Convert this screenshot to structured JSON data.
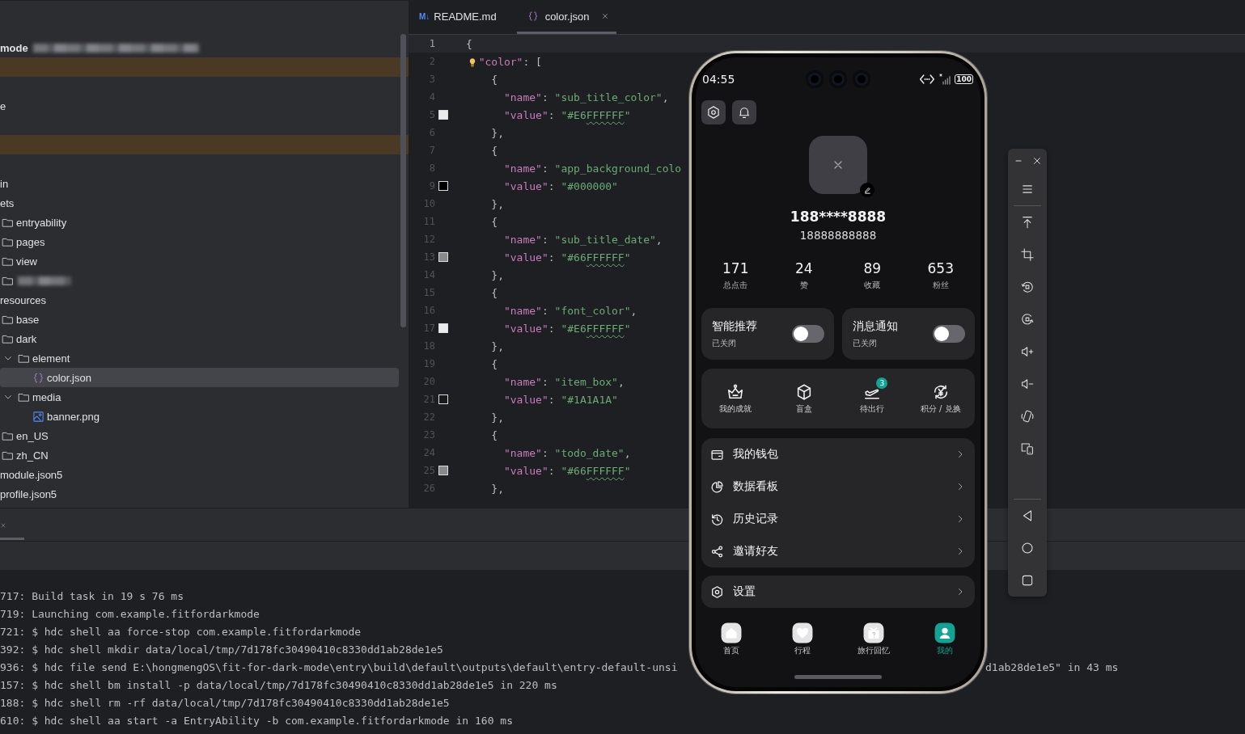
{
  "project_tree": {
    "items": [
      {
        "kind": "root",
        "label": "mode",
        "selected": false
      },
      {
        "kind": "blank",
        "highlighted": true
      },
      {
        "kind": "blank",
        "highlighted": false
      },
      {
        "kind": "plain",
        "label": "e",
        "selected": false
      },
      {
        "kind": "blank",
        "highlighted": false
      },
      {
        "kind": "blank",
        "highlighted": true
      },
      {
        "kind": "blank",
        "highlighted": false
      },
      {
        "kind": "plain",
        "label": "in",
        "selected": false
      },
      {
        "kind": "plain",
        "label": "ets",
        "selected": false,
        "children": [
          {
            "kind": "folder",
            "label": "entryability",
            "selected": false
          },
          {
            "kind": "folder",
            "label": "pages",
            "selected": false
          },
          {
            "kind": "folder",
            "label": "view",
            "selected": false
          },
          {
            "kind": "redacted-folder",
            "selected": false
          }
        ]
      },
      {
        "kind": "plain",
        "label": "resources",
        "selected": false,
        "children": [
          {
            "kind": "folder",
            "label": "base",
            "selected": false
          },
          {
            "kind": "folder",
            "label": "dark",
            "selected": false,
            "children": [
              {
                "kind": "folder",
                "label": "element",
                "selected": false,
                "expanded": true,
                "children": [
                  {
                    "kind": "json",
                    "label": "color.json",
                    "selected": true
                  }
                ]
              },
              {
                "kind": "folder",
                "label": "media",
                "selected": false,
                "expanded": true,
                "children": [
                  {
                    "kind": "image",
                    "label": "banner.png",
                    "selected": false
                  }
                ]
              }
            ]
          },
          {
            "kind": "folder",
            "label": "en_US",
            "selected": false
          },
          {
            "kind": "folder",
            "label": "zh_CN",
            "selected": false
          }
        ]
      },
      {
        "kind": "plain",
        "label": "module.json5",
        "selected": false
      },
      {
        "kind": "plain",
        "label": "profile.json5",
        "selected": false
      }
    ]
  },
  "editor": {
    "tabs": [
      {
        "kind": "markdown",
        "badge": "M↓",
        "label": "README.md",
        "selected": false
      },
      {
        "kind": "json",
        "label": "color.json",
        "selected": true
      }
    ],
    "lines": [
      {
        "n": "1",
        "text": "{",
        "current": true,
        "hint": false,
        "spellcheck": false
      },
      {
        "n": "2",
        "text": "  \"color\": [",
        "current": false,
        "hint": true,
        "spellcheck": false
      },
      {
        "n": "3",
        "text": "    {",
        "current": false,
        "hint": false,
        "spellcheck": false
      },
      {
        "n": "4",
        "text": "      \"name\": \"sub_title_color\",",
        "current": false,
        "hint": false,
        "spellcheck": false
      },
      {
        "n": "5",
        "text": "      \"value\": \"#E6FFFFFF\"",
        "current": false,
        "hint": false,
        "spellcheck": true,
        "color": "#ebebeb"
      },
      {
        "n": "6",
        "text": "    },",
        "current": false,
        "hint": false,
        "spellcheck": false
      },
      {
        "n": "7",
        "text": "    {",
        "current": false,
        "hint": false,
        "spellcheck": false
      },
      {
        "n": "8",
        "text": "      \"name\": \"app_background_colo",
        "current": false,
        "hint": false,
        "spellcheck": false
      },
      {
        "n": "9",
        "text": "      \"value\": \"#000000\"",
        "current": false,
        "hint": false,
        "spellcheck": false,
        "color": "#000000"
      },
      {
        "n": "10",
        "text": "    },",
        "current": false,
        "hint": false,
        "spellcheck": false
      },
      {
        "n": "11",
        "text": "    {",
        "current": false,
        "hint": false,
        "spellcheck": false
      },
      {
        "n": "12",
        "text": "      \"name\": \"sub_title_date\",",
        "current": false,
        "hint": false,
        "spellcheck": false
      },
      {
        "n": "13",
        "text": "      \"value\": \"#66FFFFFF\"",
        "current": false,
        "hint": false,
        "spellcheck": true,
        "color": "#8a8a8a"
      },
      {
        "n": "14",
        "text": "    },",
        "current": false,
        "hint": false,
        "spellcheck": false
      },
      {
        "n": "15",
        "text": "    {",
        "current": false,
        "hint": false,
        "spellcheck": false
      },
      {
        "n": "16",
        "text": "      \"name\": \"font_color\",",
        "current": false,
        "hint": false,
        "spellcheck": false
      },
      {
        "n": "17",
        "text": "      \"value\": \"#E6FFFFFF\"",
        "current": false,
        "hint": false,
        "spellcheck": true,
        "color": "#ebebeb"
      },
      {
        "n": "18",
        "text": "    },",
        "current": false,
        "hint": false,
        "spellcheck": false
      },
      {
        "n": "19",
        "text": "    {",
        "current": false,
        "hint": false,
        "spellcheck": false
      },
      {
        "n": "20",
        "text": "      \"name\": \"item_box\",",
        "current": false,
        "hint": false,
        "spellcheck": false
      },
      {
        "n": "21",
        "text": "      \"value\": \"#1A1A1A\"",
        "current": false,
        "hint": false,
        "spellcheck": false,
        "color": "#1a1a1a"
      },
      {
        "n": "22",
        "text": "    },",
        "current": false,
        "hint": false,
        "spellcheck": false
      },
      {
        "n": "23",
        "text": "    {",
        "current": false,
        "hint": false,
        "spellcheck": false
      },
      {
        "n": "24",
        "text": "      \"name\": \"todo_date\",",
        "current": false,
        "hint": false,
        "spellcheck": false
      },
      {
        "n": "25",
        "text": "      \"value\": \"#66FFFFFF\"",
        "current": false,
        "hint": false,
        "spellcheck": true,
        "color": "#8a8a8a"
      },
      {
        "n": "26",
        "text": "    },",
        "current": false,
        "hint": false,
        "spellcheck": false
      }
    ]
  },
  "terminal": {
    "lines": [
      {
        "text": "717: Build task in 19 s 76 ms"
      },
      {
        "text": "719: Launching com.example.fitfordarkmode"
      },
      {
        "text": "721: $ hdc shell aa force-stop com.example.fitfordarkmode"
      },
      {
        "text": "392: $ hdc shell mkdir data/local/tmp/7d178fc30490410c8330dd1ab28de1e5"
      },
      {
        "text": "936: $ hdc file send E:\\hongmengOS\\fit-for-dark-mode\\entry\\build\\default\\outputs\\default\\entry-default-unsi",
        "tail": "d1ab28de1e5\" in 43 ms"
      },
      {
        "text": "157: $ hdc shell bm install -p data/local/tmp/7d178fc30490410c8330dd1ab28de1e5 in 220 ms"
      },
      {
        "text": "188: $ hdc shell rm -rf data/local/tmp/7d178fc30490410c8330dd1ab28de1e5"
      },
      {
        "text": "610: $ hdc shell aa start -a EntryAbility -b com.example.fitfordarkmode in 160 ms"
      }
    ]
  },
  "phone": {
    "status_bar": {
      "time": "04:55",
      "battery": "100"
    },
    "profile": {
      "name": "188****8888",
      "phone": "18888888888"
    },
    "stats": [
      {
        "value": "171",
        "label": "总点击"
      },
      {
        "value": "24",
        "label": "赞"
      },
      {
        "value": "89",
        "label": "收藏"
      },
      {
        "value": "653",
        "label": "粉丝"
      }
    ],
    "toggles": [
      {
        "title": "智能推荐",
        "status": "已关闭",
        "on": false
      },
      {
        "title": "消息通知",
        "status": "已关闭",
        "on": false
      }
    ],
    "actions": [
      {
        "label": "我的成就"
      },
      {
        "label": "盲盒"
      },
      {
        "label": "待出行",
        "badge": "3"
      },
      {
        "label": "积分 / 兑换"
      }
    ],
    "menu": [
      {
        "label": "我的钱包"
      },
      {
        "label": "数据看板"
      },
      {
        "label": "历史记录"
      },
      {
        "label": "邀请好友"
      }
    ],
    "settings": {
      "label": "设置"
    },
    "tabs": [
      {
        "label": "首页",
        "selected": false
      },
      {
        "label": "行程",
        "selected": false
      },
      {
        "label": "旅行回忆",
        "selected": false
      },
      {
        "label": "我的",
        "selected": true
      }
    ]
  }
}
